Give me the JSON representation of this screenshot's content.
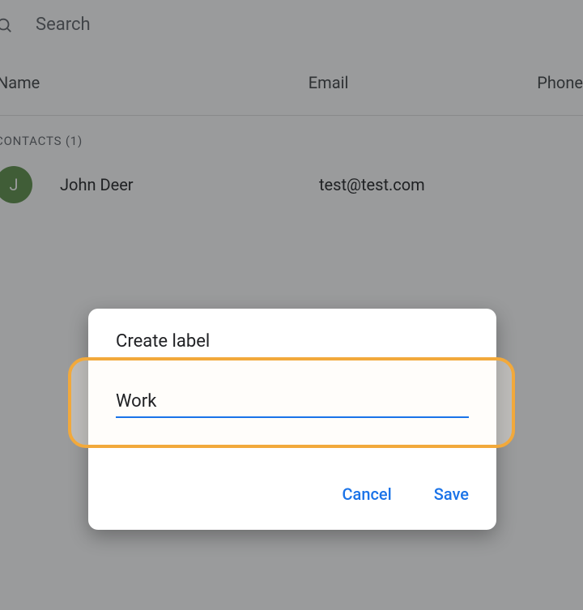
{
  "search": {
    "placeholder": "Search"
  },
  "columns": {
    "name": "Name",
    "email": "Email",
    "phone": "Phone"
  },
  "section": {
    "title": "CONTACTS (1)"
  },
  "contact": {
    "initial": "J",
    "name": "John Deer",
    "email": "test@test.com"
  },
  "dialog": {
    "title": "Create label",
    "input_value": "Work",
    "cancel": "Cancel",
    "save": "Save"
  }
}
